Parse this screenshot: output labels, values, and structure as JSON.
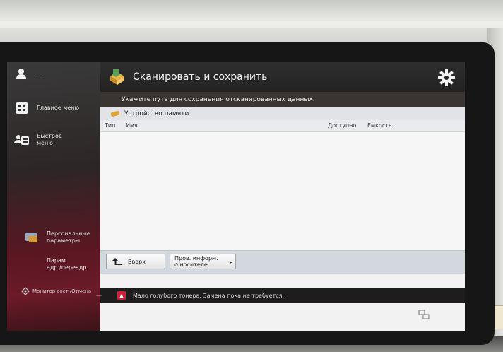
{
  "sidebar": {
    "user_dash": "—",
    "items": [
      {
        "label_line1": "Главное меню",
        "label_line2": "",
        "icon": "home-icon"
      },
      {
        "label_line1": "Быстрое",
        "label_line2": "меню",
        "icon": "quick-menu-icon"
      },
      {
        "label_line1": "Персональные",
        "label_line2": "параметры",
        "icon": "personal-settings-icon"
      },
      {
        "label_line1": "Парам.",
        "label_line2": "адр./переадр.",
        "icon": "address-settings-icon"
      }
    ],
    "monitor_label": "Монитор сост./Отмена"
  },
  "header": {
    "title": "Сканировать и сохранить",
    "title_icon": "scan-save-icon",
    "settings_icon": "gear-icon"
  },
  "main": {
    "instruction": "Укажите путь для сохранения отсканированных данных.",
    "location": "Устройство памяти",
    "table": {
      "columns": [
        "Тип",
        "Имя",
        "Доступно",
        "Емкость"
      ],
      "rows": []
    },
    "buttons": {
      "up_label": "Вверх",
      "info_line1": "Пров. информ.",
      "info_line2": "о носителе"
    }
  },
  "status_bar": {
    "dash": "—",
    "message": "Мало голубого тонера. Замена пока не требуется."
  },
  "colors": {
    "sidebar_accent": "#6b1a28",
    "status_icon": "#d3203a",
    "panel_bg": "#f2f2f2"
  }
}
